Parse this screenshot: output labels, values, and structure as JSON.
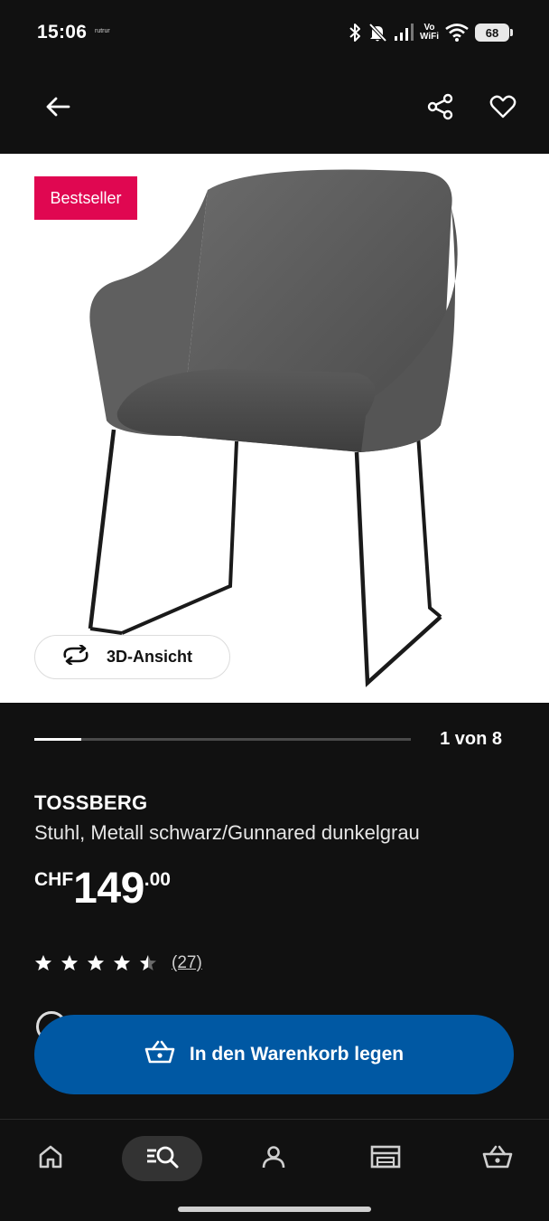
{
  "status_bar": {
    "time": "15:06",
    "carrier_mark": "rutrur",
    "vowifi_top": "Vo",
    "vowifi_bottom": "WiFi",
    "battery": "68",
    "icons": [
      "bluetooth-icon",
      "mute-icon",
      "signal-icon",
      "vowifi-icon",
      "wifi-icon",
      "battery-icon"
    ]
  },
  "header": {
    "icons": [
      "arrow-left-icon",
      "share-icon",
      "heart-icon"
    ]
  },
  "media": {
    "badge": "Bestseller",
    "view_3d_label": "3D-Ansicht",
    "pager_text": "1 von 8",
    "pager_progress": 0.125,
    "badge_color": "#e00751"
  },
  "product": {
    "name": "TOSSBERG",
    "description": "Stuhl, Metall schwarz/Gunnared dunkelgrau",
    "price_currency": "CHF",
    "price_integer": "149",
    "price_decimal": ".00",
    "rating": 4.5,
    "rating_max": 5,
    "review_count": "(27)"
  },
  "actions": {
    "add_to_cart": "In den Warenkorb legen",
    "accent_color": "#0058a3"
  },
  "bottom_nav": {
    "items": [
      {
        "icon": "home-icon",
        "active": false
      },
      {
        "icon": "search-icon",
        "active": true
      },
      {
        "icon": "profile-icon",
        "active": false
      },
      {
        "icon": "store-icon",
        "active": false
      },
      {
        "icon": "cart-icon",
        "active": false
      }
    ]
  }
}
